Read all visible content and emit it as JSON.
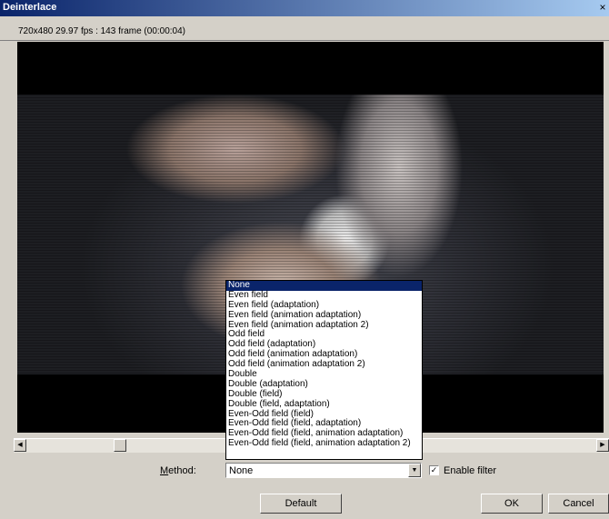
{
  "window": {
    "title": "Deinterlace",
    "close_label": "×"
  },
  "info": {
    "text": "720x480 29.97 fps : 143 frame (00:00:04)"
  },
  "scrollbar": {
    "left_arrow": "◀",
    "right_arrow": "▶"
  },
  "method": {
    "label_underlined": "M",
    "label_rest": "ethod:",
    "selected": "None",
    "arrow": "▼",
    "options": [
      "None",
      "Even field",
      "Even field (adaptation)",
      "Even field (animation adaptation)",
      "Even field (animation adaptation 2)",
      "Odd field",
      "Odd field (adaptation)",
      "Odd field (animation adaptation)",
      "Odd field (animation adaptation 2)",
      "Double",
      "Double (adaptation)",
      "Double (field)",
      "Double (field, adaptation)",
      "Even-Odd field (field)",
      "Even-Odd field (field, adaptation)",
      "Even-Odd field (field, animation adaptation)",
      "Even-Odd field (field, animation adaptation 2)"
    ]
  },
  "enable_filter": {
    "label": "Enable filter",
    "check": "✓"
  },
  "buttons": {
    "default": "Default",
    "ok": "OK",
    "cancel": "Cancel"
  }
}
